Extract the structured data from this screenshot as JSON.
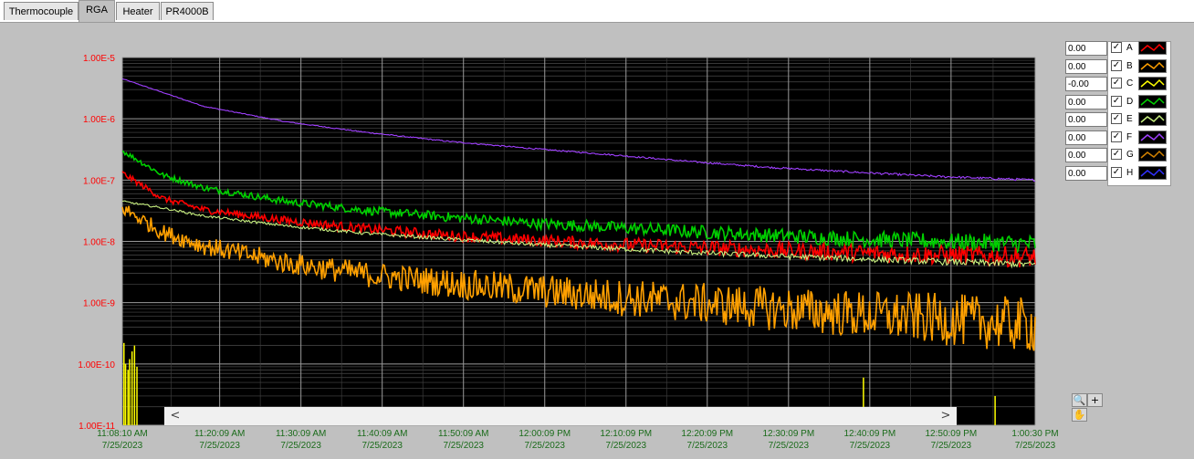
{
  "tabs": [
    {
      "label": "Thermocouple",
      "active": false
    },
    {
      "label": "RGA",
      "active": true
    },
    {
      "label": "Heater",
      "active": false
    },
    {
      "label": "PR4000B",
      "active": false
    }
  ],
  "legend": [
    {
      "value": "0.00",
      "name": "A",
      "color": "#ff0000",
      "checked": true
    },
    {
      "value": "0.00",
      "name": "B",
      "color": "#ffa000",
      "checked": true
    },
    {
      "value": "-0.00",
      "name": "C",
      "color": "#ffff00",
      "checked": true
    },
    {
      "value": "0.00",
      "name": "D",
      "color": "#00d000",
      "checked": true
    },
    {
      "value": "0.00",
      "name": "E",
      "color": "#c8f080",
      "checked": true
    },
    {
      "value": "0.00",
      "name": "F",
      "color": "#a040ff",
      "checked": true
    },
    {
      "value": "0.00",
      "name": "G",
      "color": "#d08000",
      "checked": true
    },
    {
      "value": "0.00",
      "name": "H",
      "color": "#3030ff",
      "checked": true
    }
  ],
  "scrollbar": {
    "left_arrow": "<",
    "right_arrow": ">"
  },
  "palette": {
    "zoom_icon": "zoom-icon",
    "cursor_icon": "crosshair-icon",
    "pan_icon": "hand-icon"
  },
  "chart_data": {
    "type": "line",
    "y_scale": "log",
    "ylim": [
      1e-11,
      1e-05
    ],
    "y_tick_labels": [
      "1.00E-5",
      "1.00E-6",
      "1.00E-7",
      "1.00E-8",
      "1.00E-9",
      "1.00E-10",
      "1.00E-11"
    ],
    "y_tick_values": [
      1e-05,
      1e-06,
      1e-07,
      1e-08,
      1e-09,
      1e-10,
      1e-11
    ],
    "x_range": [
      "11:08:10 AM",
      "1:00:30 PM"
    ],
    "x_range_minutes": [
      0,
      112.33
    ],
    "x_tick_labels": [
      {
        "time": "11:08:10 AM",
        "date": "7/25/2023"
      },
      {
        "time": "11:20:09 AM",
        "date": "7/25/2023"
      },
      {
        "time": "11:30:09 AM",
        "date": "7/25/2023"
      },
      {
        "time": "11:40:09 AM",
        "date": "7/25/2023"
      },
      {
        "time": "11:50:09 AM",
        "date": "7/25/2023"
      },
      {
        "time": "12:00:09 PM",
        "date": "7/25/2023"
      },
      {
        "time": "12:10:09 PM",
        "date": "7/25/2023"
      },
      {
        "time": "12:20:09 PM",
        "date": "7/25/2023"
      },
      {
        "time": "12:30:09 PM",
        "date": "7/25/2023"
      },
      {
        "time": "12:40:09 PM",
        "date": "7/25/2023"
      },
      {
        "time": "12:50:09 PM",
        "date": "7/25/2023"
      },
      {
        "time": "1:00:30 PM",
        "date": "7/25/2023"
      }
    ],
    "x_tick_minutes": [
      0,
      11.98,
      21.98,
      31.98,
      41.98,
      51.98,
      61.98,
      71.98,
      81.98,
      91.98,
      101.98,
      112.33
    ],
    "grid": true,
    "background": "#000000",
    "series": [
      {
        "name": "F",
        "color": "#a040ff",
        "noise": 0.005,
        "x": [
          0,
          10,
          20,
          30,
          40,
          50,
          60,
          70,
          80,
          90,
          100,
          112.33
        ],
        "values": [
          4.5e-06,
          1.6e-06,
          9e-07,
          6e-07,
          4.3e-07,
          3.3e-07,
          2.6e-07,
          2e-07,
          1.6e-07,
          1.35e-07,
          1.15e-07,
          1e-07
        ]
      },
      {
        "name": "D",
        "color": "#00d000",
        "noise": 0.04,
        "x": [
          0,
          5,
          10,
          20,
          30,
          40,
          50,
          60,
          70,
          80,
          90,
          100,
          112.33
        ],
        "values": [
          3e-07,
          1.2e-07,
          7.5e-08,
          4.5e-08,
          3.2e-08,
          2.5e-08,
          2e-08,
          1.7e-08,
          1.45e-08,
          1.25e-08,
          1.1e-08,
          1e-08,
          9e-09
        ]
      },
      {
        "name": "A",
        "color": "#ff0000",
        "noise": 0.045,
        "x": [
          0,
          5,
          10,
          20,
          30,
          40,
          50,
          60,
          70,
          80,
          90,
          100,
          112.33
        ],
        "values": [
          1.3e-07,
          5e-08,
          3.3e-08,
          2.2e-08,
          1.6e-08,
          1.25e-08,
          1.05e-08,
          9e-09,
          8e-09,
          7.2e-09,
          6.5e-09,
          6e-09,
          5.5e-09
        ]
      },
      {
        "name": "E",
        "color": "#c8f080",
        "noise": 0.015,
        "x": [
          0,
          5,
          10,
          20,
          30,
          40,
          50,
          60,
          70,
          80,
          90,
          100,
          112.33
        ],
        "values": [
          4.5e-08,
          3.5e-08,
          2.6e-08,
          1.8e-08,
          1.35e-08,
          1.1e-08,
          9e-09,
          7.7e-09,
          6.6e-09,
          5.8e-09,
          5.2e-09,
          4.7e-09,
          4.2e-09
        ]
      },
      {
        "name": "B",
        "color": "#ffa000",
        "noise": 0.12,
        "x": [
          0,
          5,
          10,
          20,
          30,
          40,
          50,
          60,
          70,
          80,
          90,
          100,
          112.33
        ],
        "values": [
          3.5e-08,
          1.4e-08,
          8.5e-09,
          4.5e-09,
          2.9e-09,
          2.1e-09,
          1.6e-09,
          1.25e-09,
          1e-09,
          8e-10,
          6.5e-10,
          5.5e-10,
          4.2e-10
        ]
      },
      {
        "name": "C",
        "color": "#ffff00",
        "type": "spikes",
        "x": [
          0.2,
          0.4,
          0.7,
          0.9,
          1.2,
          1.5,
          1.8,
          91.2,
          107.4
        ],
        "values": [
          2.2e-10,
          1e-10,
          8e-11,
          1.2e-10,
          1.6e-10,
          2e-10,
          9e-11,
          6e-11,
          3e-11
        ]
      }
    ]
  }
}
